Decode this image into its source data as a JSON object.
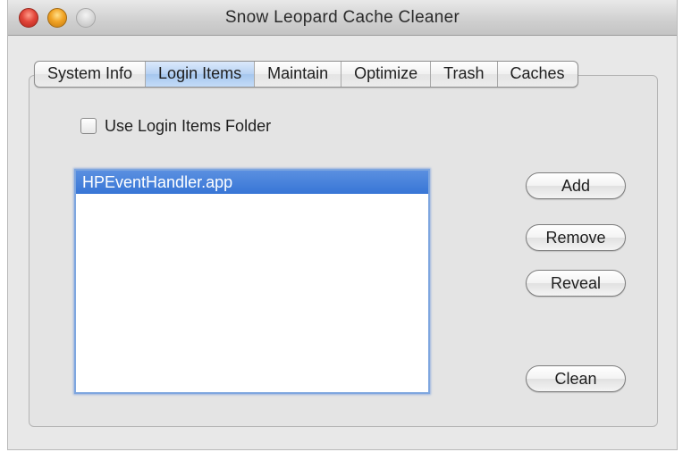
{
  "window": {
    "title": "Snow Leopard Cache Cleaner"
  },
  "tabs": [
    {
      "label": "System Info",
      "active": false
    },
    {
      "label": "Login Items",
      "active": true
    },
    {
      "label": "Maintain",
      "active": false
    },
    {
      "label": "Optimize",
      "active": false
    },
    {
      "label": "Trash",
      "active": false
    },
    {
      "label": "Caches",
      "active": false
    }
  ],
  "login_items": {
    "use_folder_label": "Use Login Items Folder",
    "use_folder_checked": false,
    "items": [
      {
        "name": "HPEventHandler.app",
        "selected": true
      }
    ],
    "buttons": {
      "add": "Add",
      "remove": "Remove",
      "reveal": "Reveal",
      "clean": "Clean"
    }
  },
  "colors": {
    "selection": "#3876d6",
    "active_tab": "#b6d1f3",
    "close": "#e2463a",
    "minimize": "#f1a325"
  }
}
